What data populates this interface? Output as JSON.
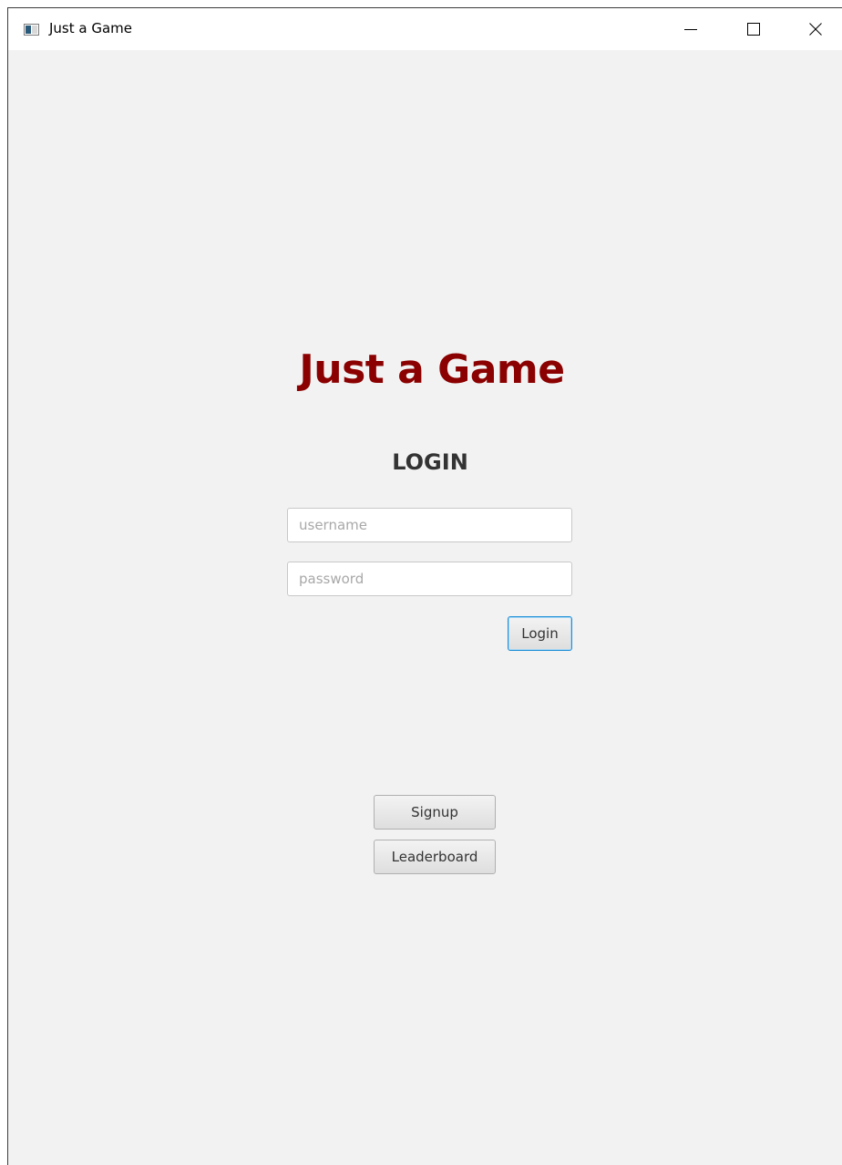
{
  "window": {
    "title": "Just a Game"
  },
  "titlebar_buttons": {
    "minimize_icon": "minimize-icon",
    "maximize_icon": "maximize-icon",
    "close_icon": "close-icon"
  },
  "main": {
    "game_title": "Just a Game",
    "login_heading": "LOGIN",
    "username_placeholder": "username",
    "username_value": "",
    "password_placeholder": "password",
    "password_value": "",
    "login_label": "Login",
    "signup_label": "Signup",
    "leaderboard_label": "Leaderboard"
  },
  "colors": {
    "title_color": "#8b0000",
    "heading_color": "#333333",
    "background": "#f2f2f2",
    "focus_border": "#1e8fd6"
  }
}
